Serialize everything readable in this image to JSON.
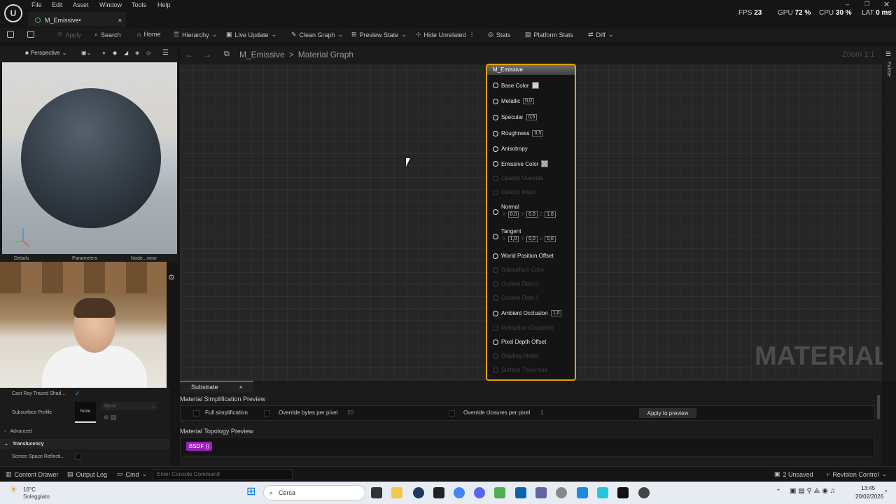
{
  "menu": {
    "logo": "U",
    "items": [
      "File",
      "Edit",
      "Asset",
      "Window",
      "Tools",
      "Help"
    ]
  },
  "tab": {
    "title": "M_Emissive•",
    "close": "×"
  },
  "stats": {
    "fps_label": "FPS",
    "fps": "23",
    "gpu_label": "GPU",
    "gpu": "72 %",
    "cpu_label": "CPU",
    "cpu": "30 %",
    "lat_label": "LAT",
    "lat": "0 ms"
  },
  "toolbar": {
    "apply": "Apply",
    "search": "Search",
    "home": "Home",
    "hierarchy": "Hierarchy",
    "live_update": "Live Update",
    "clean_graph": "Clean Graph",
    "preview_state": "Preview State",
    "hide_unrelated": "Hide Unrelated",
    "stats": "Stats",
    "platform_stats": "Platform Stats",
    "diff": "Diff"
  },
  "viewport": {
    "mode": "Perspective"
  },
  "panel_tabs": [
    "Details",
    "Parameters",
    "Node...view"
  ],
  "breadcrumb": {
    "root": "M_Emissive",
    "sep": ">",
    "current": "Material Graph"
  },
  "zoom": "Zoom 1:1",
  "watermark": "MATERIAL",
  "palette": "Palette",
  "node": {
    "title": "M_Emissive",
    "base_color": "Base Color",
    "metallic": "Metallic",
    "metallic_val": "0,0",
    "specular": "Specular",
    "specular_val": "0,5",
    "roughness": "Roughness",
    "roughness_val": "0,5",
    "anisotropy": "Anisotropy",
    "emissive": "Emissive Color",
    "opacity_override": "Opacity Override",
    "opacity_mask": "Opacity Mask",
    "normal": "Normal",
    "normal_x": "0,0",
    "normal_y": "0,0",
    "normal_z": "1,0",
    "tangent": "Tangent",
    "tangent_x": "1,0",
    "tangent_y": "0,0",
    "tangent_z": "0,0",
    "x": "X",
    "y": "Y",
    "z": "Z",
    "wpo": "World Position Offset",
    "subsurface": "Subsurface Color",
    "custom0": "Custom Data 0",
    "custom1": "Custom Data 1",
    "ao": "Ambient Occlusion",
    "ao_val": "1,0",
    "refraction": "Refraction (Disabled)",
    "pdo": "Pixel Depth Offset",
    "shading": "Shading Model",
    "thickness": "Surface Thickness"
  },
  "details": {
    "cast_ray": "Cast Ray Traced Shad...",
    "subsurface_profile": "Subsurface Profile",
    "none": "None",
    "none_dropdown": "None",
    "advanced": "Advanced",
    "translucency": "Translucency",
    "ssr": "Screen Space Reflecti..."
  },
  "substrate": {
    "tab": "Substrate",
    "close": "×",
    "sim_title": "Material Simplification Preview",
    "full_simp": "Full simplification",
    "override_bytes": "Override bytes per pixel",
    "bytes_val": "20",
    "override_closures": "Override closures per pixel",
    "closures_val": "1",
    "apply_preview": "Apply to preview",
    "topo_title": "Material Topology Preview",
    "bsdf": "BSDF ()"
  },
  "statusbar": {
    "content_drawer": "Content Drawer",
    "output_log": "Output Log",
    "cmd": "Cmd",
    "console_placeholder": "Enter Console Command",
    "unsaved": "2 Unsaved",
    "revision": "Revision Control"
  },
  "taskbar": {
    "temp": "16°C",
    "weather": "Soleggiato",
    "search": "Cerca",
    "time": "13:45",
    "date": "20/02/2026"
  }
}
